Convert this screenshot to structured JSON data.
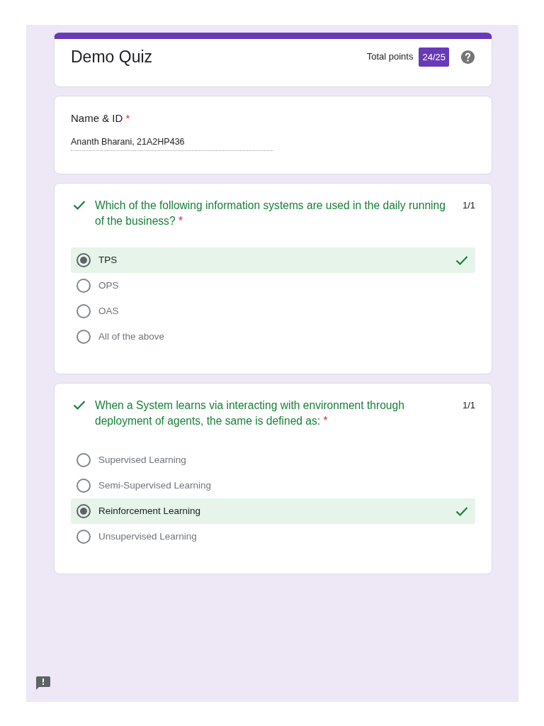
{
  "header": {
    "title": "Demo Quiz",
    "points_label": "Total points",
    "score": "24/25"
  },
  "fields": [
    {
      "label": "Name & ID",
      "required_mark": "*",
      "value": "Ananth Bharani, 21A2HP436"
    }
  ],
  "questions": [
    {
      "text": "Which of the following information systems are used in the daily running of the business?",
      "required_mark": "*",
      "correct": true,
      "points": "1/1",
      "options": [
        {
          "label": "TPS",
          "selected": true,
          "correct": true
        },
        {
          "label": "OPS",
          "selected": false,
          "correct": false
        },
        {
          "label": "OAS",
          "selected": false,
          "correct": false
        },
        {
          "label": "All of the above",
          "selected": false,
          "correct": false
        }
      ]
    },
    {
      "text": "When a System learns via interacting with environment through deployment of agents, the same is defined as:",
      "required_mark": "*",
      "correct": true,
      "points": "1/1",
      "options": [
        {
          "label": "Supervised Learning",
          "selected": false,
          "correct": false
        },
        {
          "label": "Semi-Supervised Learning",
          "selected": false,
          "correct": false
        },
        {
          "label": "Reinforcement Learning",
          "selected": true,
          "correct": true
        },
        {
          "label": "Unsupervised Learning",
          "selected": false,
          "correct": false
        }
      ]
    }
  ]
}
